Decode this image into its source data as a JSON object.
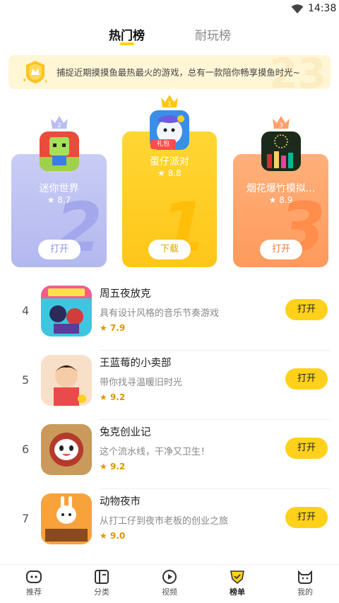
{
  "status_bar": {
    "time": "14:38"
  },
  "top_tabs": [
    {
      "label": "热门榜",
      "active": true
    },
    {
      "label": "耐玩榜",
      "active": false
    }
  ],
  "banner": {
    "text": "捕捉近期摸摸鱼最热最火的游戏，总有一款陪你畅享摸鱼时光~"
  },
  "podium": [
    {
      "rank": "2",
      "name": "迷你世界",
      "rating": "8.7",
      "button": "打开"
    },
    {
      "rank": "1",
      "name": "蛋仔派对",
      "rating": "8.8",
      "button": "下载",
      "tag": "礼包"
    },
    {
      "rank": "3",
      "name": "烟花爆竹模拟...",
      "rating": "8.9",
      "button": "打开"
    }
  ],
  "list": [
    {
      "rank": "4",
      "title": "周五夜放克",
      "desc": "具有设计风格的音乐节奏游戏",
      "rating": "7.9",
      "button": "打开"
    },
    {
      "rank": "5",
      "title": "王蓝莓的小卖部",
      "desc": "带你找寻温暖旧时光",
      "rating": "9.2",
      "button": "打开"
    },
    {
      "rank": "6",
      "title": "兔克创业记",
      "desc": "这个流水线，干净又卫生！",
      "rating": "9.2",
      "button": "打开"
    },
    {
      "rank": "7",
      "title": "动物夜市",
      "desc": "从打工仔到夜市老板的创业之旅",
      "rating": "9.0",
      "button": "打开"
    }
  ],
  "bottom_nav": [
    {
      "label": "推荐",
      "icon": "gamepad-icon"
    },
    {
      "label": "分类",
      "icon": "category-icon"
    },
    {
      "label": "视频",
      "icon": "video-icon"
    },
    {
      "label": "榜单",
      "icon": "ranking-icon",
      "active": true
    },
    {
      "label": "我的",
      "icon": "profile-cat-icon"
    }
  ],
  "colors": {
    "accent": "#ffd11a",
    "silver": "#b3b8ef",
    "gold": "#ffc61a",
    "bronze": "#ff9a5c"
  }
}
